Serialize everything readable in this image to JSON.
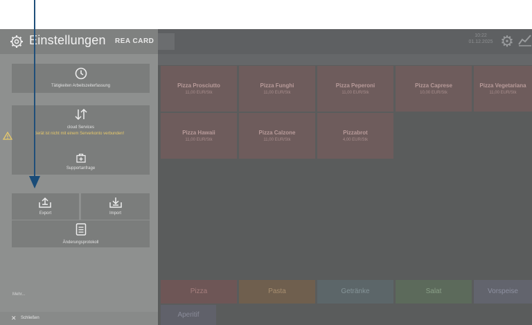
{
  "topbar": {
    "time": "10:22",
    "date": "01.12.2025"
  },
  "tiles": [
    {
      "name": "Pizza Prosciutto",
      "price": "11,00 EUR/Stk"
    },
    {
      "name": "Pizza Funghi",
      "price": "11,00 EUR/Stk"
    },
    {
      "name": "Pizza Peperoni",
      "price": "11,00 EUR/Stk"
    },
    {
      "name": "Pizza Caprese",
      "price": "10,00 EUR/Stk"
    },
    {
      "name": "Pizza Vegetariana",
      "price": "11,00 EUR/Stk"
    },
    {
      "name": "Pizza Hawaii",
      "price": "11,00 EUR/Stk"
    },
    {
      "name": "Pizza Calzone",
      "price": "11,00 EUR/Stk"
    },
    {
      "name": "Pizzabrot",
      "price": "4,00 EUR/Stk"
    }
  ],
  "categories": [
    "Pizza",
    "Pasta",
    "Getränke",
    "Salat",
    "Vorspeise",
    "Aperitif"
  ],
  "panel": {
    "title": "Einstellungen",
    "brand": "REA CARD",
    "time_tracking": "Tätigkeiten Arbeitszeiterfassung",
    "cloud_services": "cloud Services",
    "cloud_warning": "Gerät ist nicht mit einem Serverkonto verbunden!",
    "support_request": "Supportanfrage",
    "export": "Export",
    "import": "Import",
    "change_log": "Änderungsprotokoll",
    "more": "Mehr...",
    "close": "Schließen"
  },
  "colors": {
    "annotation_arrow": "#1a4c78",
    "warning": "#e8c96a"
  }
}
